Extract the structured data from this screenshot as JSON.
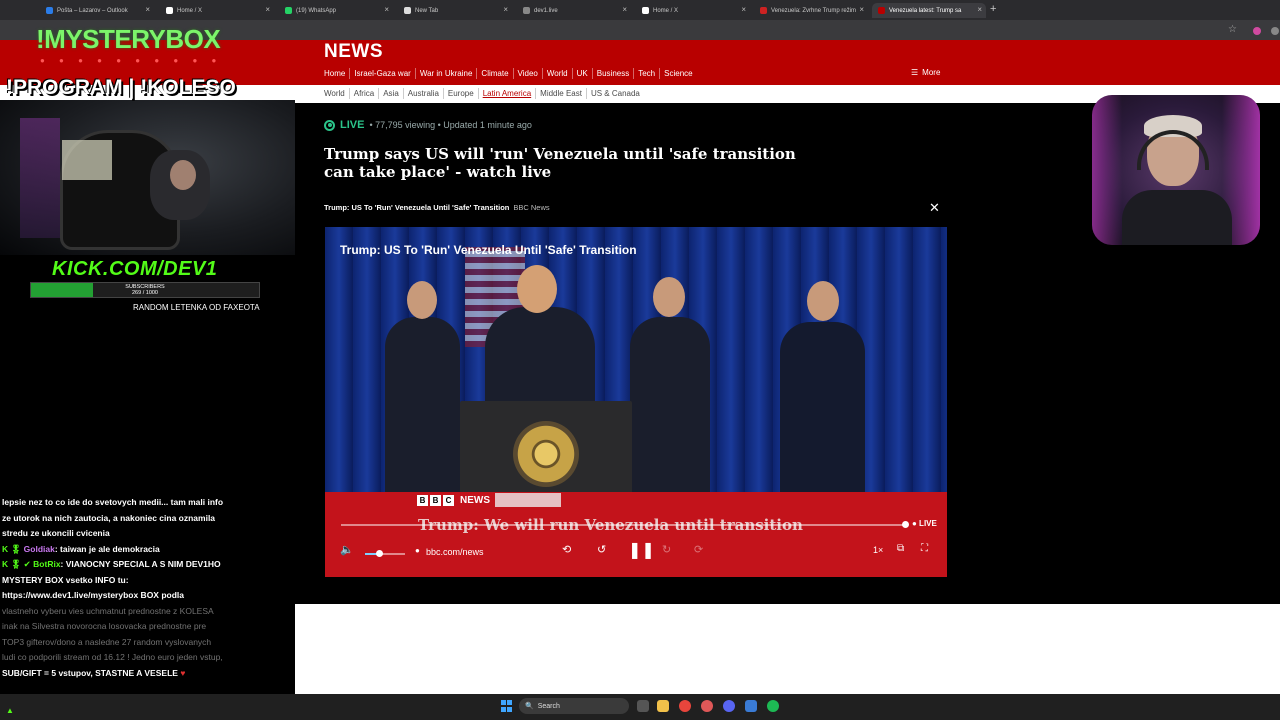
{
  "tabs": [
    {
      "label": "Pošta – Lazarov – Outlook",
      "color": "#2b7de9"
    },
    {
      "label": "Home / X",
      "color": "#ffffff"
    },
    {
      "label": "(19) WhatsApp",
      "color": "#25d366"
    },
    {
      "label": "New Tab",
      "color": "#dddddd"
    },
    {
      "label": "dev1.live",
      "color": "#888888"
    },
    {
      "label": "Home / X",
      "color": "#ffffff"
    },
    {
      "label": "Venezuela: Zvrhne Trump režim",
      "color": "#cc2222"
    },
    {
      "label": "Venezuela latest: Trump sa",
      "color": "#b80000"
    }
  ],
  "bbc": {
    "brand": "NEWS",
    "nav": [
      "Home",
      "Israel-Gaza war",
      "War in Ukraine",
      "Climate",
      "Video",
      "World",
      "UK",
      "Business",
      "Tech",
      "Science"
    ],
    "more": "More",
    "subnav": [
      "World",
      "Africa",
      "Asia",
      "Australia",
      "Europe",
      "Latin America",
      "Middle East",
      "US & Canada"
    ],
    "subnav_active": "Latin America"
  },
  "article": {
    "live_label": "LIVE",
    "live_meta": "• 77,795 viewing • Updated 1 minute ago",
    "headline": "Trump says US will 'run' Venezuela until 'safe transition can take place' - watch live",
    "caption_title": "Trump: US To 'Run' Venezuela Until 'Safe' Transition",
    "caption_source": "BBC News"
  },
  "video": {
    "title": "Trump: US To 'Run' Venezuela Until 'Safe' Transition",
    "ticker": "Trump: We will run Venezuela until transition",
    "live_badge": "● LIVE",
    "url": "bbc.com/news",
    "logo_letters": [
      "B",
      "B",
      "C"
    ],
    "logo_word": "NEWS",
    "volume_level": 0.35,
    "speed": "1×"
  },
  "stream": {
    "mysterybox": "!MYSTERYBOX",
    "program": "!PROGRAM | !KOLESO",
    "kick": "KICK.COM/DEV1",
    "subs_label": "SUBSCRIBERS",
    "subs_count": "269 / 1000",
    "subs_progress": 0.269,
    "random": "RANDOM LETENKA OD FAXEOTA"
  },
  "chat": [
    {
      "type": "text",
      "text": "lepsie nez to co ide do svetovych medii... tam mali info ze utorok na nich zautocia, a nakoniec cina oznamila stredu ze ukoncili cvicenia"
    },
    {
      "type": "msg",
      "badges": "K 🎖",
      "name": "Goldiak",
      "text": ": taiwan je ale demokracia"
    },
    {
      "type": "msg",
      "badges": "K 🎖 ✔",
      "name": "BotRix",
      "text": ": VIANOCNY SPECIAL A S NIM DEV1HO MYSTERY BOX vsetko INFO tu: https://www.dev1.live/mysterybox BOX podla"
    },
    {
      "type": "fade",
      "text": "vlastneho vyberu vies uchmatnut prednostne z KOLESA inak na Silvestra novorocna losovacka prednostne pre TOP3 gifterov/dono a nasledne 27 random vyslovanych ludi co podporili stream od 16.12 ! Jedno euro jeden vstup,"
    },
    {
      "type": "end",
      "text": "SUB/GIFT = 5 vstupov, STASTNE A VESELE"
    }
  ],
  "taskbar": {
    "search_placeholder": "Search"
  }
}
